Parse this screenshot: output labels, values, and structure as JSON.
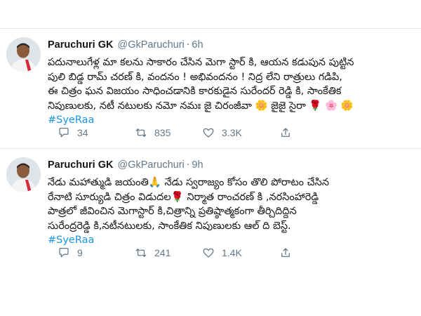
{
  "tweets": [
    {
      "name": "Paruchuri GK",
      "handle": "@GkParuchuri",
      "separator": "·",
      "time": "6h",
      "text_lines": [
        "పదునాలుగేళ్ల మా కలను సాకారం చేసిన మెగా స్టార్ కి, ఆయన కడుపున పుట్టిన",
        "పులి బిడ్డ రామ్ చరణ్ కి, వందనం ! అభివందనం ! నిద్ర లేని రాత్రులు గడిపి,",
        "ఈ చిత్రం ఘన విజయం సాధించడానికి కారకుడైన సురేందర్ రెడ్డి కి, సాంకేతిక",
        "నిపుణులకు, నటీ నటులకు నమో నమః జై చిరంజీవా 🌼 జైజై సైరా 🌹 🌸 🌼"
      ],
      "hashtag": "#SyeRaa",
      "replies": "34",
      "retweets": "835",
      "likes": "3.3K"
    },
    {
      "name": "Paruchuri GK",
      "handle": "@GkParuchuri",
      "separator": "·",
      "time": "9h",
      "text_lines": [
        "నేడు మహాత్ముడి జయంతి🙏 నేడు స్వరాజ్యం కోసం తొలి పోరాటం చేసిన",
        "రేనాటి సూర్యుడి చిత్రం విడుదల🌹 నిర్మాత రాంచరణ్ కి ,నరసింహారెడ్డి",
        "పాత్రలో జీవించిన మెగాస్టార్ కి,చిత్రాన్ని ప్రతిష్ఠాత్మకంగా తీర్చిదిద్దిన",
        "సురేంద్రరెడ్డి కి,నటీనటులకు, సాంకేతిక నిపుణులకు ఆల్ ది బెస్ట్."
      ],
      "hashtag": "#SyeRaa",
      "replies": "9",
      "retweets": "241",
      "likes": "1.4K"
    }
  ],
  "icons": {
    "reply": "speech-bubble-icon",
    "retweet": "retweet-arrows-icon",
    "like": "heart-icon"
  },
  "colors": {
    "link": "#1b95e0",
    "muted": "#657786",
    "text": "#14171a",
    "border": "#e1e8ed"
  }
}
